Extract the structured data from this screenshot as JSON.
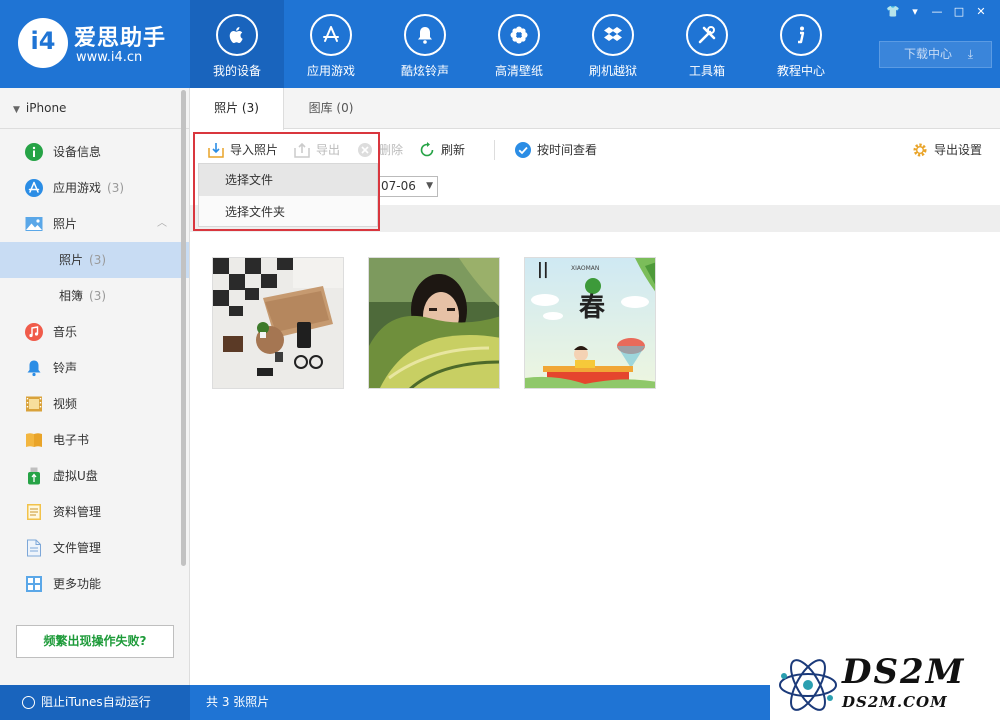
{
  "app": {
    "logo_name": "爱思助手",
    "logo_url": "www.i4.cn",
    "logo_mark": "i4"
  },
  "nav": [
    {
      "label": "我的设备",
      "icon": "apple-icon"
    },
    {
      "label": "应用游戏",
      "icon": "app-store-icon"
    },
    {
      "label": "酷炫铃声",
      "icon": "bell-icon"
    },
    {
      "label": "高清壁纸",
      "icon": "flower-icon"
    },
    {
      "label": "刷机越狱",
      "icon": "dropbox-icon"
    },
    {
      "label": "工具箱",
      "icon": "tools-icon"
    },
    {
      "label": "教程中心",
      "icon": "info-icon"
    }
  ],
  "header": {
    "download_center": "下载中心"
  },
  "sidebar": {
    "device_name": "iPhone",
    "items": [
      {
        "label": "设备信息",
        "count": "",
        "icon": "info-icon"
      },
      {
        "label": "应用游戏",
        "count": "(3)",
        "icon": "app-store-icon"
      },
      {
        "label": "照片",
        "count": "",
        "icon": "photo-icon"
      },
      {
        "label": "照片",
        "count": "(3)",
        "icon": ""
      },
      {
        "label": "相簿",
        "count": "(3)",
        "icon": ""
      },
      {
        "label": "音乐",
        "count": "",
        "icon": "music-icon"
      },
      {
        "label": "铃声",
        "count": "",
        "icon": "bell-icon"
      },
      {
        "label": "视频",
        "count": "",
        "icon": "video-icon"
      },
      {
        "label": "电子书",
        "count": "",
        "icon": "book-icon"
      },
      {
        "label": "虚拟U盘",
        "count": "",
        "icon": "usb-icon"
      },
      {
        "label": "资料管理",
        "count": "",
        "icon": "notes-icon"
      },
      {
        "label": "文件管理",
        "count": "",
        "icon": "file-icon"
      },
      {
        "label": "更多功能",
        "count": "",
        "icon": "grid-icon"
      }
    ],
    "warn_button": "频繁出现操作失败?"
  },
  "tabs": [
    {
      "label": "照片 (3)"
    },
    {
      "label": "图库 (0)"
    }
  ],
  "toolbar": {
    "import_label": "导入照片",
    "export_label": "导出",
    "delete_label": "删除",
    "refresh_label": "刷新",
    "by_time_label": "按时间查看",
    "export_settings_label": "导出设置"
  },
  "dropdown": {
    "items": [
      "选择文件",
      "选择文件夹"
    ]
  },
  "filter": {
    "date_value": "07-06"
  },
  "status": {
    "itunes_block": "阻止iTunes自动运行",
    "photo_count": "共 3 张照片"
  },
  "photos": [
    {
      "title": "photo-desk-flatlay"
    },
    {
      "title": "photo-girl-leaf"
    },
    {
      "title": "photo-spring-poster",
      "poster_text": "春",
      "poster_sub": "XIAOMAN"
    }
  ],
  "watermark": {
    "big": "DS2M",
    "small": "DS2M.COM"
  },
  "colors": {
    "brand_blue": "#1f74d4",
    "highlight_red": "#d9363e",
    "warn_green": "#1e9b3a"
  }
}
